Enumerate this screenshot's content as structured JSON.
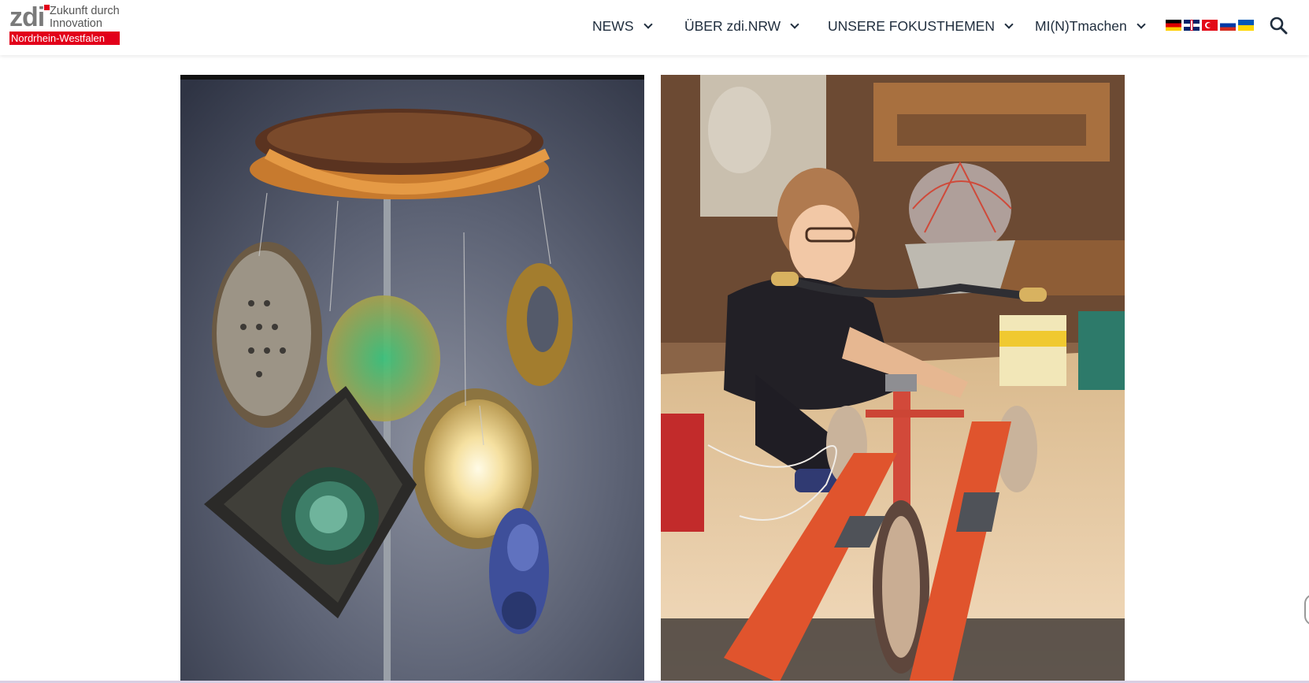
{
  "logo": {
    "mark": "zdi",
    "tagline_line1": "Zukunft durch",
    "tagline_line2": "Innovation",
    "region": "Nordrhein-Westfalen",
    "brand_color": "#e2001a"
  },
  "nav": {
    "items": [
      {
        "label": "NEWS"
      },
      {
        "label": "ÜBER zdi.NRW"
      },
      {
        "label": "UNSERE FOKUSTHEMEN"
      },
      {
        "label": "MI(N)Tmachen"
      }
    ]
  },
  "languages": [
    {
      "icon": "flag-de-icon"
    },
    {
      "icon": "flag-uk-icon"
    },
    {
      "icon": "flag-tr-icon"
    },
    {
      "icon": "flag-ru-icon"
    },
    {
      "icon": "flag-ua-icon"
    }
  ],
  "search": {
    "icon": "search-icon"
  },
  "gallery": {
    "images": [
      {
        "subject": "upcycled-lamp-mobile-photo"
      },
      {
        "subject": "girl-building-tricycle-ski-lamp-photo"
      }
    ]
  }
}
